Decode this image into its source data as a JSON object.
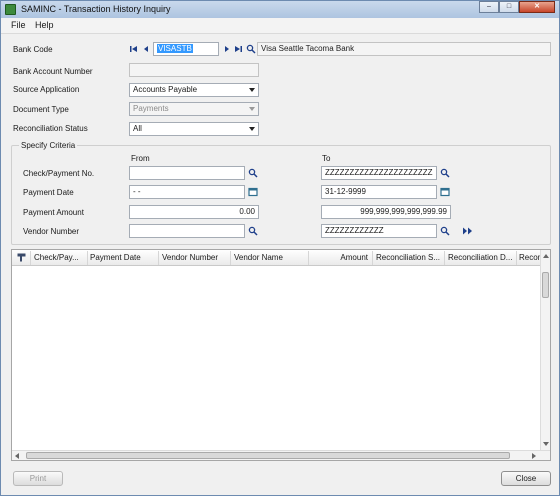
{
  "window": {
    "title": "SAMINC - Transaction History Inquiry"
  },
  "menu": [
    "File",
    "Help"
  ],
  "bank": {
    "label": "Bank Code",
    "code": "VISASTB",
    "description": "Visa Seattle Tacoma Bank"
  },
  "bank_account": {
    "label": "Bank Account Number",
    "value": ""
  },
  "source_application": {
    "label": "Source Application",
    "value": "Accounts Payable"
  },
  "document_type": {
    "label": "Document Type",
    "value": "Payments"
  },
  "reconciliation_status": {
    "label": "Reconciliation Status",
    "value": "All"
  },
  "criteria": {
    "title": "Specify Criteria",
    "from_label": "From",
    "to_label": "To",
    "rows": [
      {
        "label": "Check/Payment No.",
        "from": "",
        "to": "ZZZZZZZZZZZZZZZZZZZZZZ"
      },
      {
        "label": "Payment Date",
        "from": "- -",
        "to": "31-12-9999"
      },
      {
        "label": "Payment Amount",
        "from": "0.00",
        "to": "999,999,999,999,999.99"
      },
      {
        "label": "Vendor Number",
        "from": "",
        "to": "ZZZZZZZZZZZZ"
      }
    ]
  },
  "grid": {
    "columns": [
      "Check/Pay...",
      "Payment Date",
      "Vendor Number",
      "Vendor Name",
      "Amount",
      "Reconciliation S...",
      "Reconciliation D...",
      "Recon"
    ],
    "rows": []
  },
  "buttons": {
    "print": "Print",
    "close": "Close"
  },
  "icons": {
    "first": "first-record-icon",
    "prev": "previous-record-icon",
    "next": "next-record-icon",
    "last": "last-record-icon",
    "finder": "finder-icon",
    "calendar": "calendar-icon",
    "go": "go-icon"
  }
}
